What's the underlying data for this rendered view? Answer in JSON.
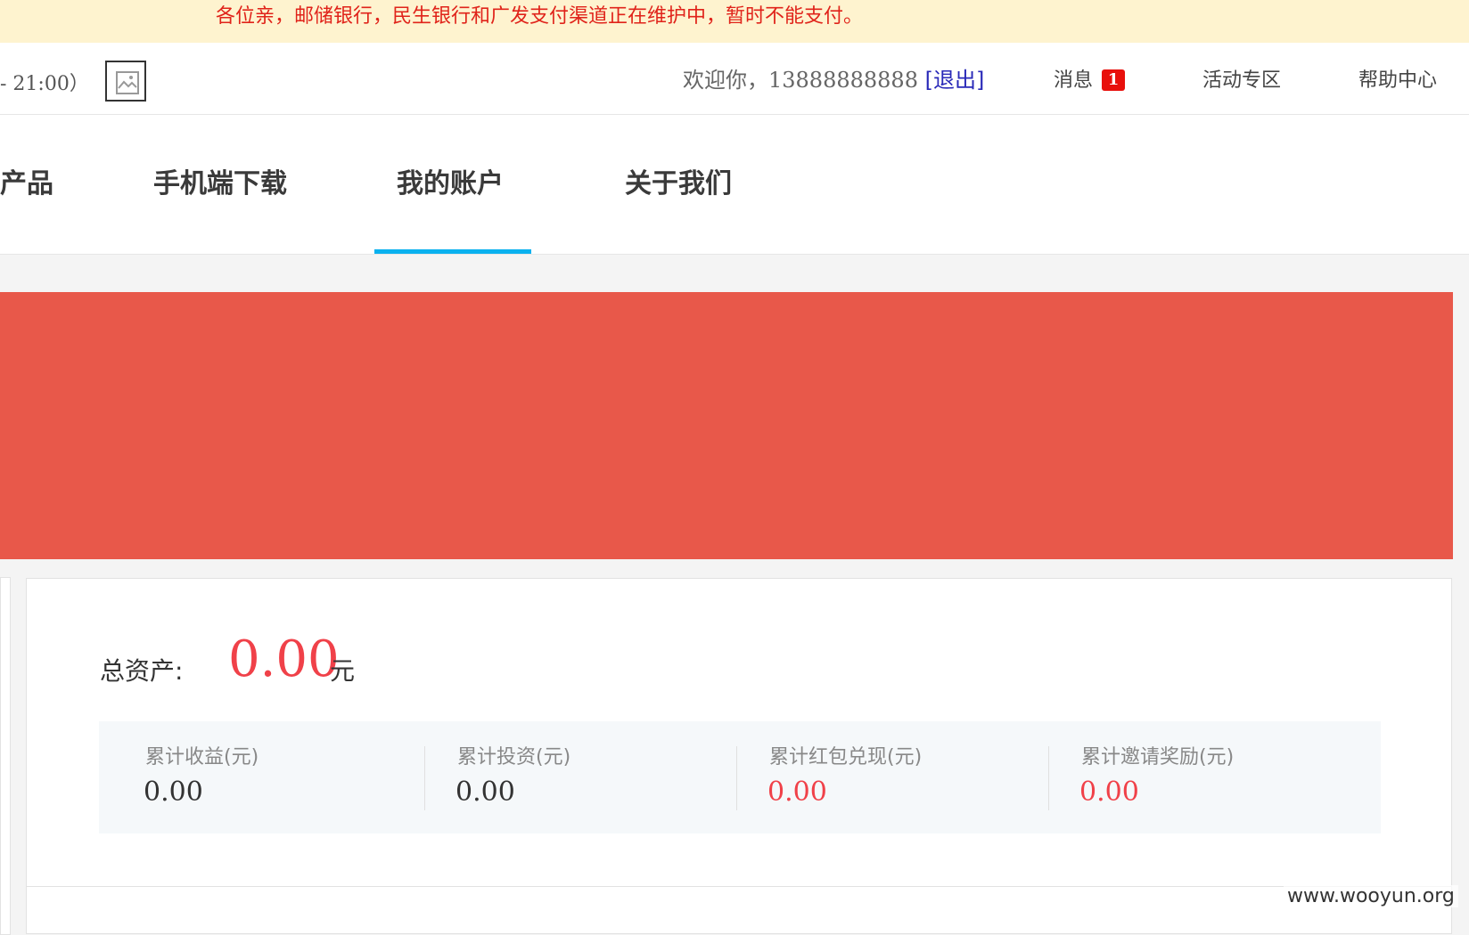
{
  "notice": {
    "text": "各位亲，邮储银行，民生银行和广发支付渠道正在维护中，暂时不能支付。"
  },
  "topbar": {
    "hours": "- 21:00）",
    "qr_icon": "qr-code-icon",
    "welcome_prefix": "欢迎你，",
    "phone": "13888888888",
    "logout": "[退出]",
    "messages_label": "消息",
    "messages_count": "1",
    "activity": "活动专区",
    "help": "帮助中心"
  },
  "nav": {
    "items": [
      {
        "label": "产品"
      },
      {
        "label": "手机端下载"
      },
      {
        "label": "我的账户",
        "active": true
      },
      {
        "label": "关于我们"
      }
    ]
  },
  "colors": {
    "banner": "#e8584a",
    "accent_red": "#f04149",
    "nav_active": "#0ab1ef",
    "notice_bg": "#fef3cf"
  },
  "account": {
    "total_label": "总资产:",
    "total_value": "0.00",
    "total_unit": "元",
    "stats": [
      {
        "label": "累计收益(元)",
        "value": "0.00"
      },
      {
        "label": "累计投资(元)",
        "value": "0.00"
      },
      {
        "label": "累计红包兑现(元)",
        "value": "0.00"
      },
      {
        "label": "累计邀请奖励(元)",
        "value": "0.00"
      }
    ]
  },
  "watermark": "www.wooyun.org"
}
